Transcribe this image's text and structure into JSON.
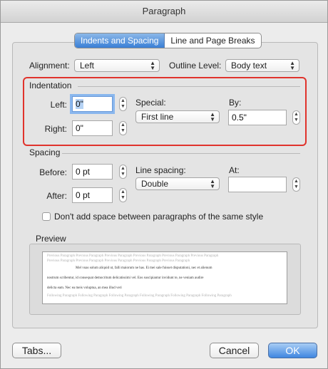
{
  "window": {
    "title": "Paragraph"
  },
  "tabs": [
    {
      "label": "Indents and Spacing",
      "active": true
    },
    {
      "label": "Line and Page Breaks",
      "active": false
    }
  ],
  "general": {
    "alignment_label": "Alignment:",
    "alignment_value": "Left",
    "outline_label": "Outline Level:",
    "outline_value": "Body text"
  },
  "indentation": {
    "heading": "Indentation",
    "left_label": "Left:",
    "left_value": "0\"",
    "right_label": "Right:",
    "right_value": "0\"",
    "special_label": "Special:",
    "special_value": "First line",
    "by_label": "By:",
    "by_value": "0.5\""
  },
  "spacing": {
    "heading": "Spacing",
    "before_label": "Before:",
    "before_value": "0 pt",
    "after_label": "After:",
    "after_value": "0 pt",
    "line_spacing_label": "Line spacing:",
    "line_spacing_value": "Double",
    "at_label": "At:",
    "at_value": ""
  },
  "checkbox": {
    "label": "Don't add space between paragraphs of the same style",
    "checked": false
  },
  "preview": {
    "heading": "Preview",
    "prev_line1": "Previous Paragraph Previous Paragraph Previous Paragraph Previous Paragraph Previous Paragraph Previous Paragraph",
    "prev_line2": "Previous Paragraph Previous Paragraph Previous Paragraph Previous Paragraph Previous Paragraph",
    "main_line1": "Mel vuas solum aliquid ut, falli maiorum ne has. Ei mei sale fuisset disputationi, nec et alienum",
    "main_line2": "nostrum scribentur, id consequat democritum delicatissimi vel. Eos suscipiantur invidunt te, ne veniam audire",
    "main_line3": "delicta eam. Nec ea meis voluptua, an mea illud veri",
    "follow_line1": "Following Paragraph Following Paragraph Following Paragraph Following Paragraph Following Paragraph Following Paragraph"
  },
  "buttons": {
    "tabs": "Tabs...",
    "cancel": "Cancel",
    "ok": "OK"
  },
  "colors": {
    "highlight": "#e0332c",
    "accent": "#3f86e0"
  }
}
